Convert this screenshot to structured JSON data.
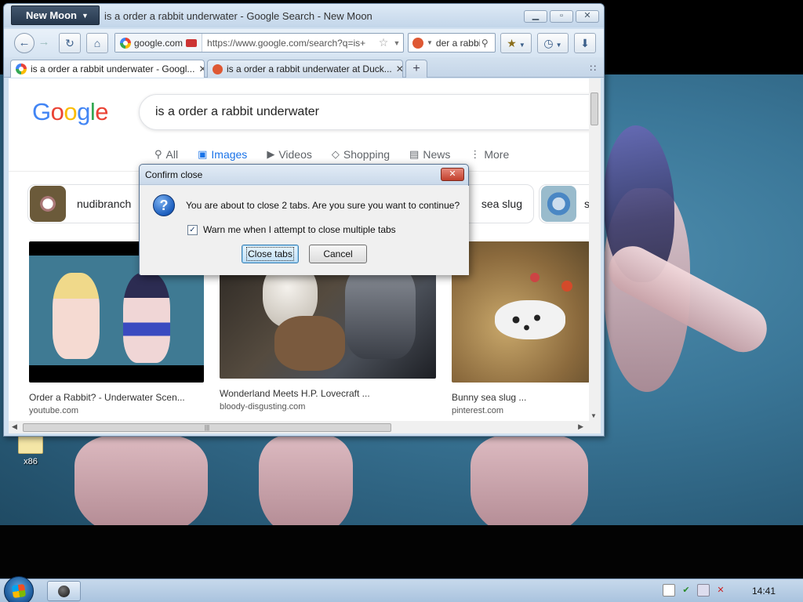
{
  "desktop": {
    "icons": [
      {
        "label": "x86",
        "icon": "folder-icon"
      }
    ]
  },
  "browser": {
    "app_menu_label": "New Moon",
    "window_title": "is a order a rabbit underwater - Google Search - New Moon",
    "url_identity": "google.com",
    "url": "https://www.google.com/search?q=is+",
    "search_value": "der a rabbit",
    "tabs": [
      {
        "label": "is a order a rabbit underwater - Googl...",
        "favicon": "google-icon",
        "active": true
      },
      {
        "label": "is a order a rabbit underwater at Duck...",
        "favicon": "duckduckgo-icon",
        "active": false
      }
    ],
    "new_tab_label": "+",
    "all_tabs_glyph": "∷"
  },
  "page": {
    "logo_letters": [
      "G",
      "o",
      "o",
      "g",
      "l",
      "e"
    ],
    "query": "is a order a rabbit underwater",
    "nav": [
      {
        "label": "All",
        "icon": "magnifier-icon",
        "active": false
      },
      {
        "label": "Images",
        "icon": "image-icon",
        "active": true
      },
      {
        "label": "Videos",
        "icon": "play-icon",
        "active": false
      },
      {
        "label": "Shopping",
        "icon": "tag-icon",
        "active": false
      },
      {
        "label": "News",
        "icon": "newspaper-icon",
        "active": false
      },
      {
        "label": "More",
        "icon": "dots-vertical-icon",
        "active": false
      }
    ],
    "chips": [
      "nudibranch",
      "sea slug",
      "s"
    ],
    "results": [
      {
        "title": "Order a Rabbit? - Underwater Scen...",
        "source": "youtube.com"
      },
      {
        "title": "Wonderland Meets H.P. Lovecraft ...",
        "source": "bloody-disgusting.com"
      },
      {
        "title": "Bunny sea slug ...",
        "source": "pinterest.com"
      }
    ]
  },
  "dialog": {
    "title": "Confirm close",
    "message": "You are about to close 2 tabs. Are you sure you want to continue?",
    "checkbox_label": "Warn me when I attempt to close multiple tabs",
    "checkbox_checked": true,
    "confirm_label": "Close tabs",
    "cancel_label": "Cancel"
  },
  "taskbar": {
    "clock": "14:41"
  },
  "colors": {
    "google_blue": "#4285f4",
    "google_red": "#ea4335",
    "google_yellow": "#fbbc05",
    "google_green": "#34a853",
    "active_nav": "#1a73e8"
  }
}
